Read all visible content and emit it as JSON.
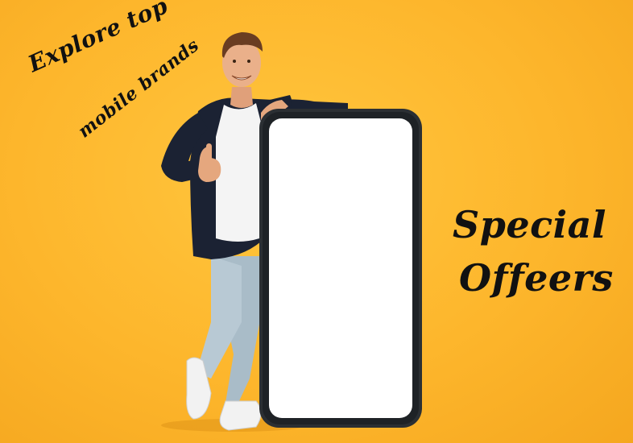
{
  "text": {
    "line1": "Explore top",
    "line2": "mobile brands",
    "headline1": "Special",
    "headline2": "Offeers"
  },
  "colors": {
    "background": "#fdb62c",
    "text": "#111111",
    "phone_frame": "#2b2f33",
    "phone_screen": "#ffffff"
  }
}
